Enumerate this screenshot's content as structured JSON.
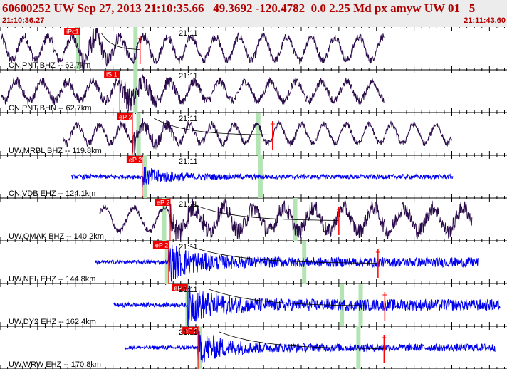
{
  "header": {
    "title": "60600252 UW Sep 27, 2013 21:10:35.66   49.3692 -120.4782  0.0 2.25 Md px amyw UW 01   5",
    "time_start": "21:10:36.27",
    "time_end": "21:11:43.60"
  },
  "colors": {
    "header_text": "#b00000",
    "header_bg": "#ececec",
    "trace_bh": "#2a0a4a",
    "trace_eh": "#0000ee",
    "pick_box": "#ee0000",
    "pick_line": "#ff0000",
    "green_band": "#b4e4b4",
    "grid": "#000000"
  },
  "chart_data": {
    "type": "seismogram",
    "x_unit": "seconds after 21:10:36.27",
    "x_range": [
      0,
      67.33
    ],
    "minute_marker": {
      "label": "21:11",
      "t": 23.73
    },
    "traces": [
      {
        "label": "CN.PNT BHZ -- 62.7km",
        "channel": "BHZ",
        "pick": "iPc1",
        "t_pick": 10.6,
        "t_start": 0.2,
        "t_end": 51.0,
        "coda_t": 18.6,
        "green": [
          10.4,
          18.0
        ],
        "amp": 0.55,
        "period": 3.2,
        "noise": 0.25,
        "burst": 0.55,
        "tail": 0.2
      },
      {
        "label": "CN.PNT BHN -- 62.7km",
        "channel": "BHN",
        "pick": "iS 1",
        "t_pick": 15.9,
        "t_start": 0.2,
        "t_end": 51.0,
        "coda_t": null,
        "green": [
          18.0
        ],
        "amp": 0.45,
        "period": 3.4,
        "noise": 0.25,
        "burst": 0.6,
        "tail": 0.2
      },
      {
        "label": "UW.MRBL BHZ -- 119.8km",
        "channel": "BHZ",
        "pick": "eP 2",
        "t_pick": 17.6,
        "t_start": 8.4,
        "t_end": 60.0,
        "coda_t": 36.2,
        "green": [
          18.4,
          34.3
        ],
        "amp": 0.45,
        "period": 3.0,
        "noise": 0.2,
        "burst": 0.5,
        "tail": 0.15
      },
      {
        "label": "CN.VDB EHZ -- 124.1km",
        "channel": "EHZ",
        "pick": "eP 2",
        "t_pick": 18.9,
        "t_start": 9.5,
        "t_end": 60.2,
        "coda_t": null,
        "green": [
          19.3,
          34.6
        ],
        "amp": 0.12,
        "period": 0.9,
        "noise": 0.12,
        "burst": 0.45,
        "tail": 0.12
      },
      {
        "label": "UW.QMAK BHZ -- 140.2km",
        "channel": "BHZ",
        "pick": "eP 2",
        "t_pick": 22.6,
        "t_start": 13.2,
        "t_end": 62.7,
        "coda_t": 45.0,
        "green": [
          21.8,
          39.2
        ],
        "amp": 0.55,
        "period": 4.0,
        "noise": 0.15,
        "burst": 0.35,
        "tail": 0.4
      },
      {
        "label": "UW.NEL EHZ -- 144.8km",
        "channel": "EHZ",
        "pick": "eP 2",
        "t_pick": 22.4,
        "t_start": 12.7,
        "t_end": 63.5,
        "coda_t": 50.2,
        "green": [
          22.2,
          40.4
        ],
        "amp": 0.08,
        "period": 0.8,
        "noise": 0.1,
        "burst": 0.85,
        "tail": 0.25
      },
      {
        "label": "UW.DY2 EHZ -- 162.4km",
        "channel": "EHZ",
        "pick": "eP 1",
        "t_pick": 24.9,
        "t_start": 15.1,
        "t_end": 66.4,
        "coda_t": 51.1,
        "green": [
          24.9,
          45.4,
          47.9
        ],
        "amp": 0.08,
        "period": 0.8,
        "noise": 0.12,
        "burst": 0.8,
        "tail": 0.3
      },
      {
        "label": "UW.WRW EHZ -- 170.8km",
        "channel": "EHZ",
        "pick": "eP 2",
        "t_pick": 26.3,
        "t_start": 16.6,
        "t_end": 65.8,
        "coda_t": 51.0,
        "green": [
          26.5,
          47.6
        ],
        "amp": 0.08,
        "period": 0.8,
        "noise": 0.1,
        "burst": 0.75,
        "tail": 0.2
      }
    ]
  }
}
